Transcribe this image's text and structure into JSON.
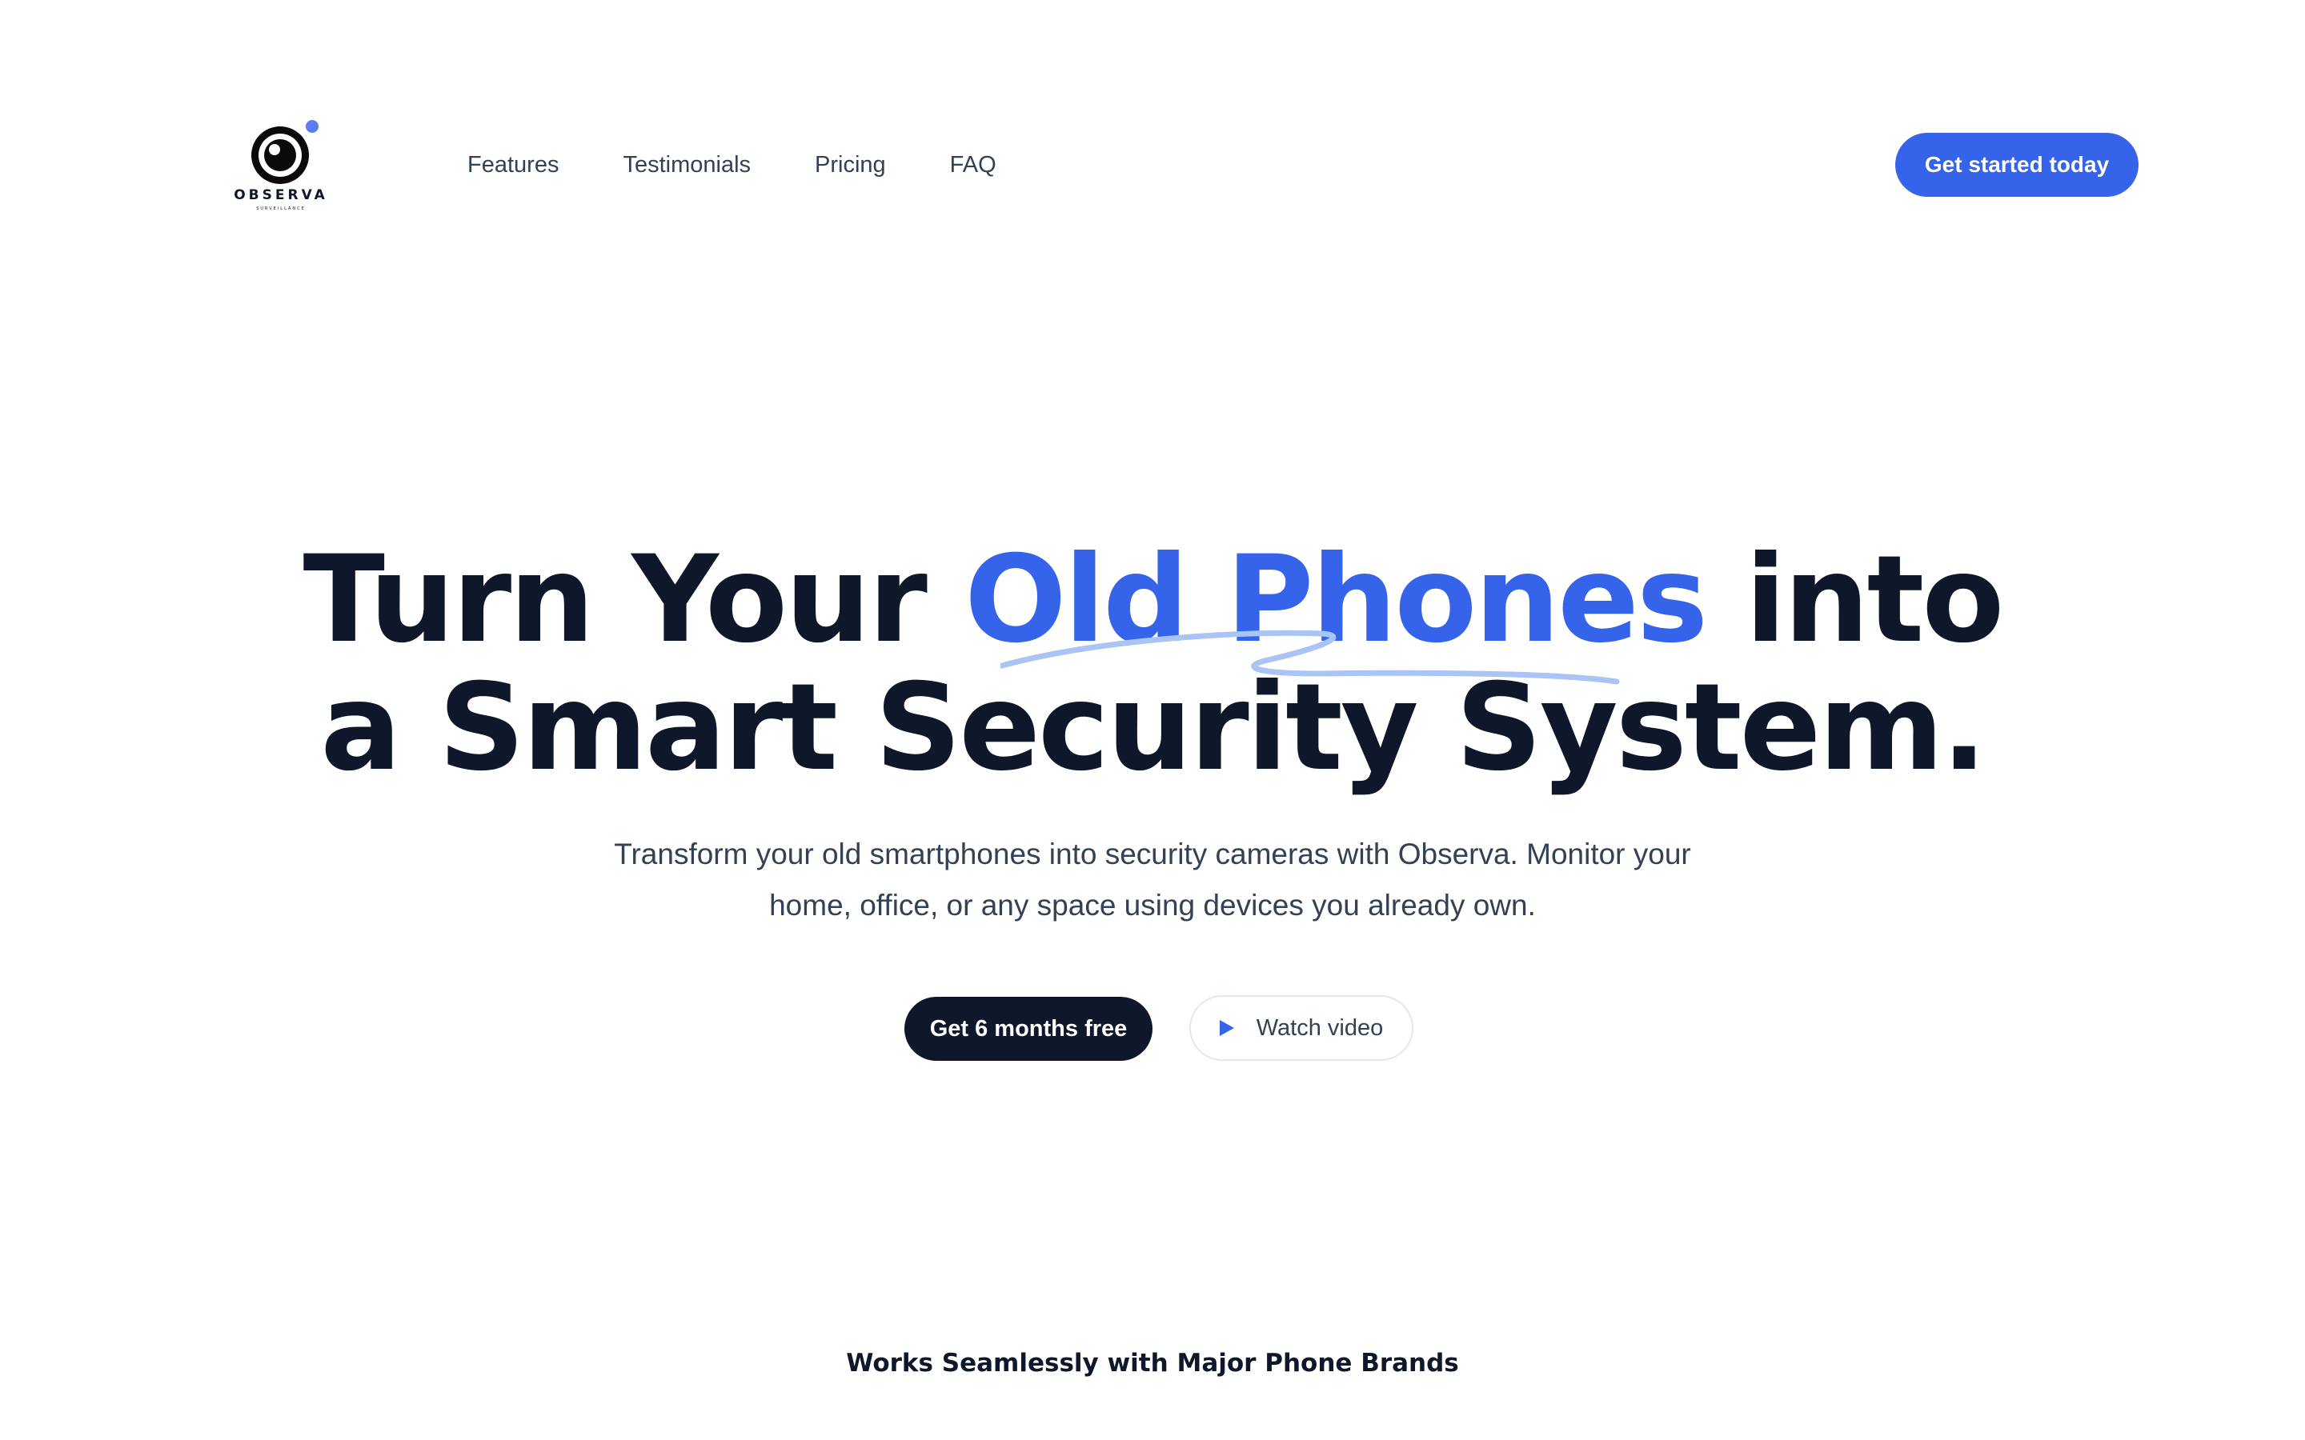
{
  "brand": {
    "name": "OBSERVA",
    "tagline": "SURVEILLANCE",
    "logo_icon": "eye-camera-icon",
    "accent_dot_color": "#5b7cf5"
  },
  "nav": {
    "items": [
      {
        "label": "Features"
      },
      {
        "label": "Testimonials"
      },
      {
        "label": "Pricing"
      },
      {
        "label": "FAQ"
      }
    ],
    "cta_label": "Get started today"
  },
  "hero": {
    "title_part1": "Turn Your ",
    "title_highlight": "Old Phones",
    "title_part2": " into",
    "title_line2": "a Smart Security System.",
    "subtitle": "Transform your old smartphones into security cameras with Observa. Monitor your home, office, or any space using devices you already own.",
    "primary_cta": "Get 6 months free",
    "secondary_cta": "Watch video",
    "secondary_icon": "play-icon"
  },
  "brands_section": {
    "title": "Works Seamlessly with Major Phone Brands"
  },
  "colors": {
    "accent": "#3563e9",
    "dark": "#0f172a",
    "text_muted": "#334155",
    "scribble": "#a9c4f5",
    "background": "#ffffff"
  }
}
